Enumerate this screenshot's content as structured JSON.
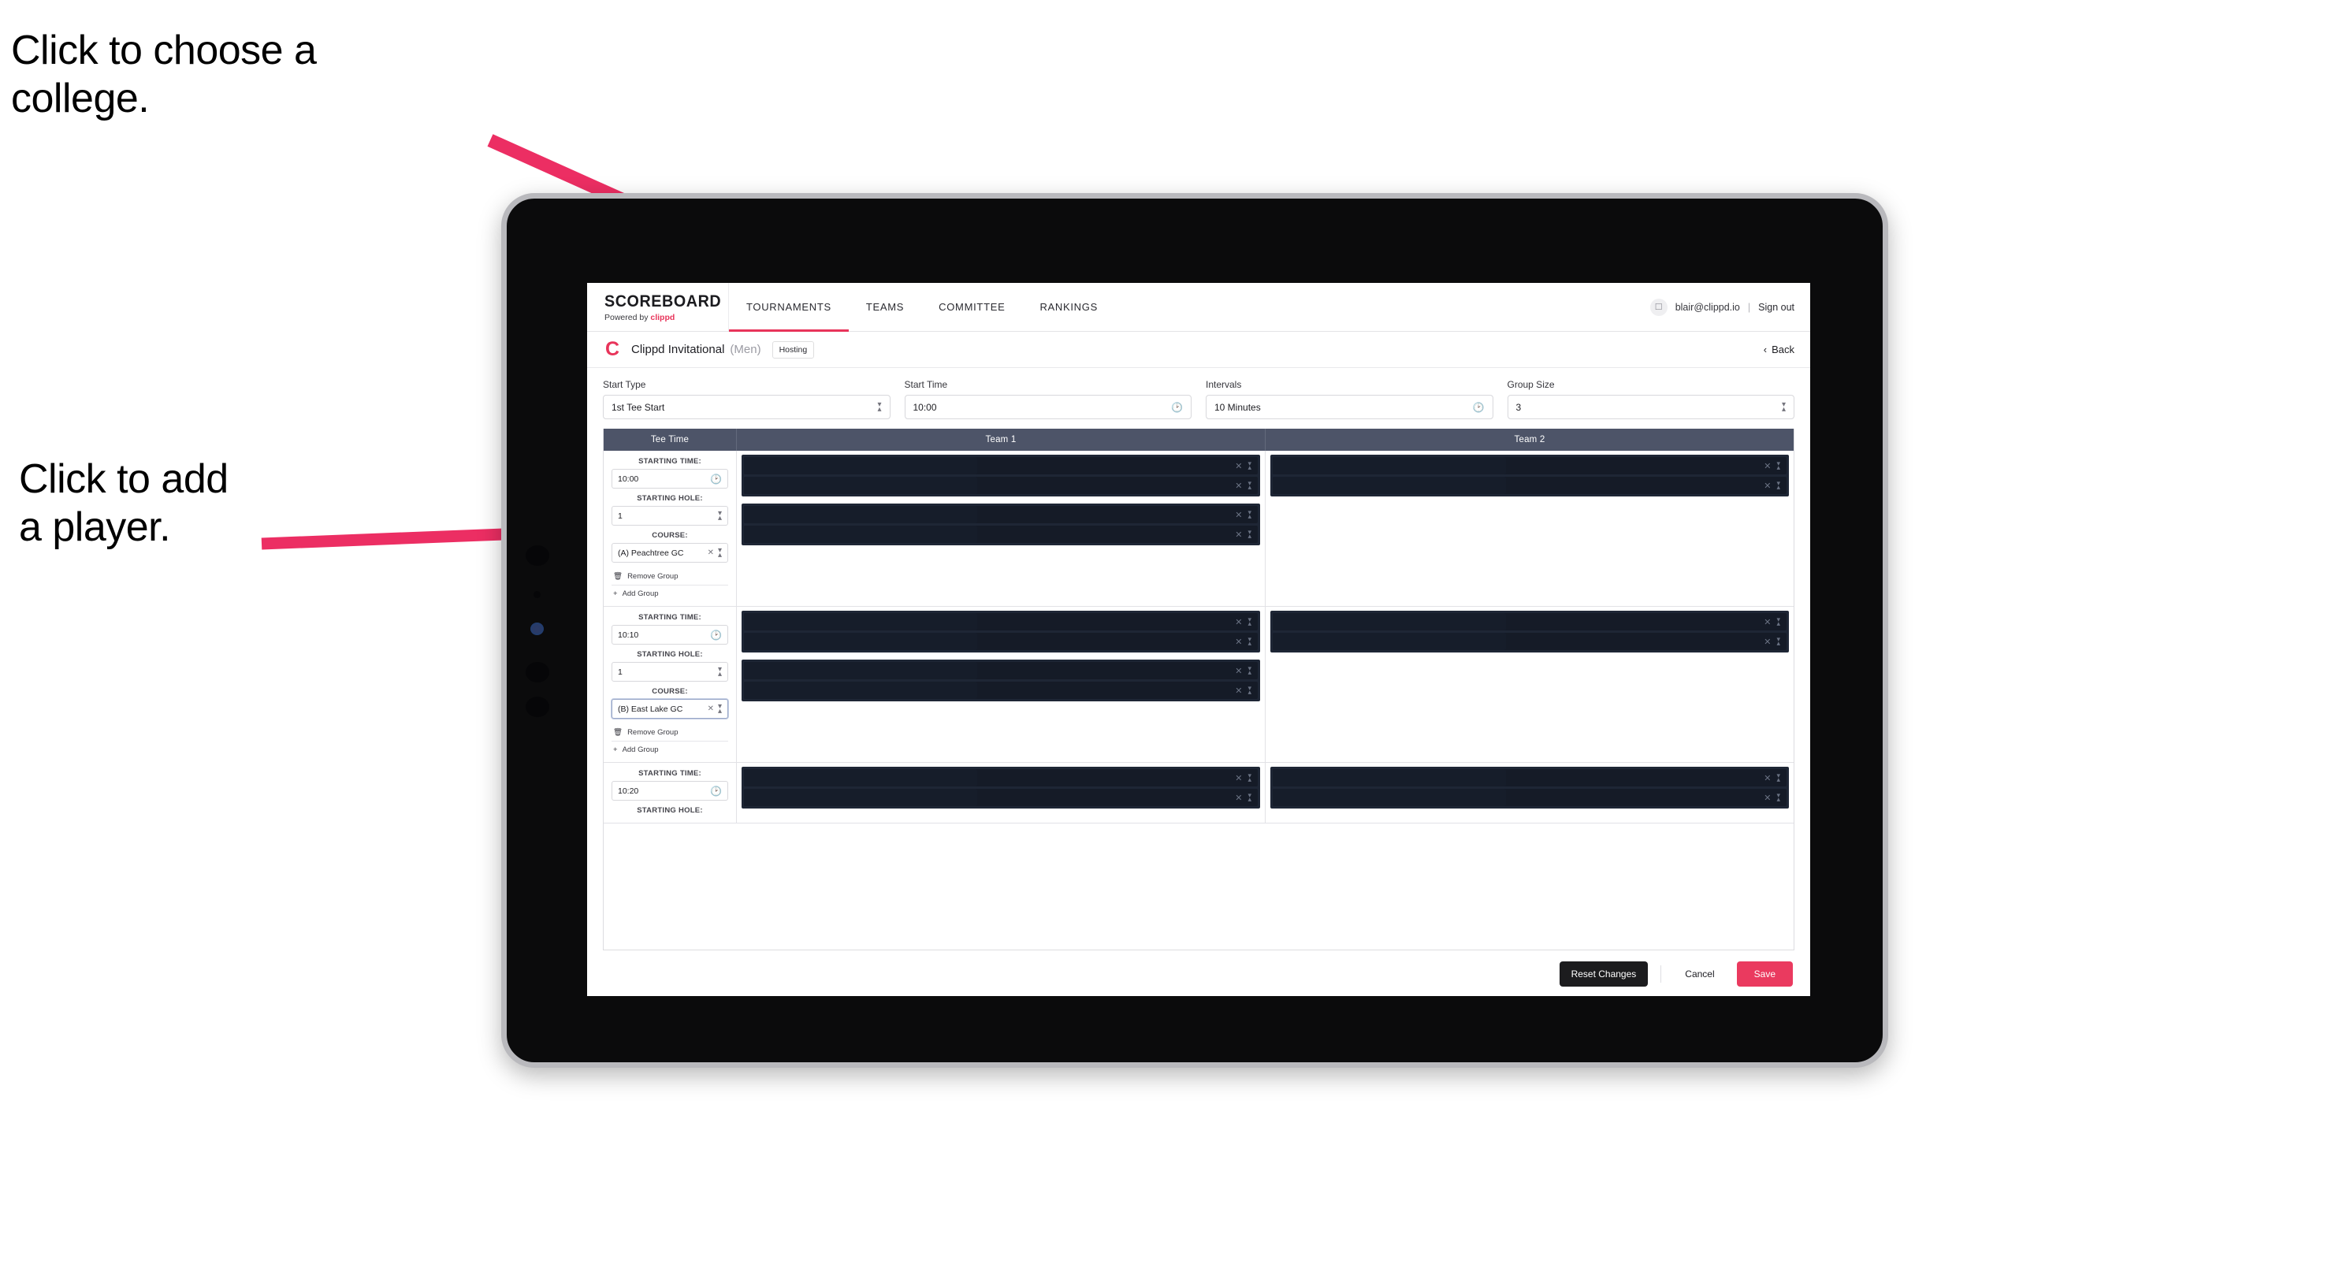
{
  "annotations": {
    "college": "Click to choose a\ncollege.",
    "player": "Click to add\na player."
  },
  "nav": {
    "brand_name": "SCOREBOARD",
    "brand_sub_prefix": "Powered by ",
    "brand_sub_highlight": "clippd",
    "tabs": [
      {
        "label": "TOURNAMENTS",
        "active": true
      },
      {
        "label": "TEAMS",
        "active": false
      },
      {
        "label": "COMMITTEE",
        "active": false
      },
      {
        "label": "RANKINGS",
        "active": false
      }
    ],
    "avatar_icon": "user-icon",
    "user_email": "blair@clippd.io",
    "separator": "|",
    "sign_out": "Sign out"
  },
  "tournament_bar": {
    "logo_glyph": "C",
    "name": "Clippd Invitational",
    "gender": "(Men)",
    "role_badge": "Hosting",
    "back_chevron": "‹",
    "back_label": "Back"
  },
  "controls": [
    {
      "label": "Start Type",
      "value": "1st Tee Start",
      "icon": "stepper-icon"
    },
    {
      "label": "Start Time",
      "value": "10:00",
      "icon": "clock-icon"
    },
    {
      "label": "Intervals",
      "value": "10 Minutes",
      "icon": "clock-icon"
    },
    {
      "label": "Group Size",
      "value": "3",
      "icon": "stepper-icon"
    }
  ],
  "table": {
    "headers": {
      "tee_time": "Tee Time",
      "team_1": "Team 1",
      "team_2": "Team 2"
    },
    "field_labels": {
      "starting_time": "STARTING TIME:",
      "starting_hole": "STARTING HOLE:",
      "course": "COURSE:"
    },
    "group_actions": {
      "remove_icon": "trash-icon",
      "remove_label": "Remove Group",
      "add_icon": "plus-icon",
      "add_label": "Add Group"
    },
    "slot_icons": {
      "clear": "close-icon",
      "reorder": "stepper-icon"
    },
    "rows": [
      {
        "starting_time": "10:00",
        "starting_hole": "1",
        "course": "(A) Peachtree GC",
        "course_focused": false,
        "team1_blocks": [
          2,
          2
        ],
        "team2_blocks": [
          2
        ]
      },
      {
        "starting_time": "10:10",
        "starting_hole": "1",
        "course": "(B) East Lake GC",
        "course_focused": true,
        "team1_blocks": [
          2,
          2
        ],
        "team2_blocks": [
          2
        ]
      },
      {
        "starting_time": "10:20",
        "starting_hole": "",
        "course": "",
        "course_focused": false,
        "team1_blocks": [
          2
        ],
        "team2_blocks": [
          2
        ]
      }
    ]
  },
  "footer": {
    "reset": "Reset Changes",
    "cancel": "Cancel",
    "save": "Save"
  },
  "colors": {
    "accent_pink": "#ea3a5f",
    "arrow_pink": "#ec2e63",
    "table_header": "#4d5468",
    "slot_block": "#1e2635",
    "slot_row": "#151b27",
    "dark_button": "#1c1c1e"
  }
}
